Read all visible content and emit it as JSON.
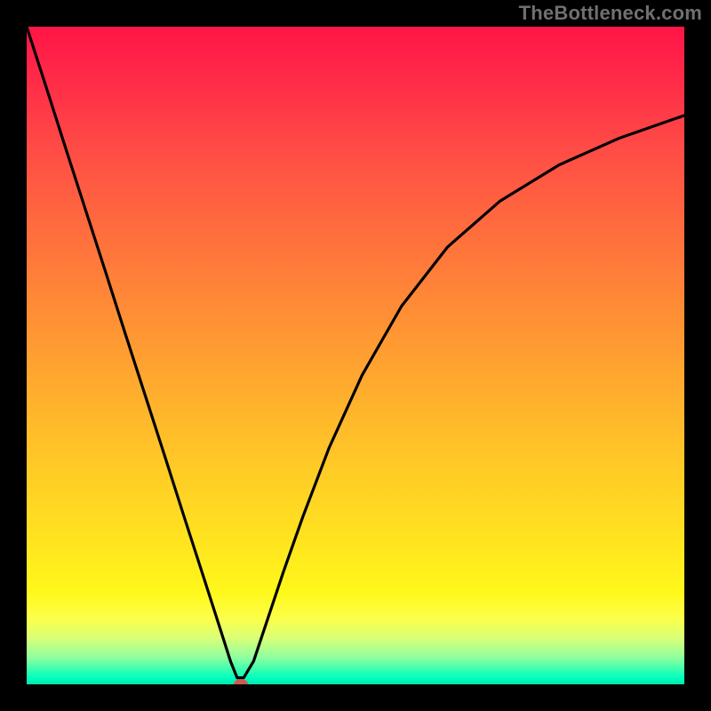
{
  "watermark": "TheBottleneck.com",
  "chart_data": {
    "type": "line",
    "title": "",
    "xlabel": "",
    "ylabel": "",
    "xlim": [
      0,
      1
    ],
    "ylim": [
      0,
      1
    ],
    "grid": false,
    "legend": false,
    "background_gradient": {
      "direction": "vertical",
      "stops": [
        {
          "pos": 0.0,
          "color": "#ff1546"
        },
        {
          "pos": 0.18,
          "color": "#ff4a46"
        },
        {
          "pos": 0.42,
          "color": "#ff8a36"
        },
        {
          "pos": 0.66,
          "color": "#ffc827"
        },
        {
          "pos": 0.86,
          "color": "#fff81a"
        },
        {
          "pos": 0.96,
          "color": "#8cffa0"
        },
        {
          "pos": 1.0,
          "color": "#00e8a8"
        }
      ]
    },
    "marker": {
      "x": 0.325,
      "y": 0.0,
      "color": "#cc5a52"
    },
    "series": [
      {
        "name": "curve",
        "color": "#000000",
        "x": [
          0.0,
          0.03,
          0.06,
          0.09,
          0.12,
          0.15,
          0.18,
          0.21,
          0.24,
          0.27,
          0.295,
          0.31,
          0.32,
          0.33,
          0.345,
          0.355,
          0.37,
          0.39,
          0.42,
          0.46,
          0.51,
          0.57,
          0.64,
          0.72,
          0.81,
          0.9,
          1.0
        ],
        "y": [
          1.0,
          0.907,
          0.813,
          0.72,
          0.627,
          0.533,
          0.44,
          0.347,
          0.253,
          0.16,
          0.082,
          0.035,
          0.01,
          0.01,
          0.035,
          0.065,
          0.11,
          0.17,
          0.255,
          0.36,
          0.47,
          0.575,
          0.665,
          0.735,
          0.79,
          0.83,
          0.865
        ]
      }
    ]
  }
}
